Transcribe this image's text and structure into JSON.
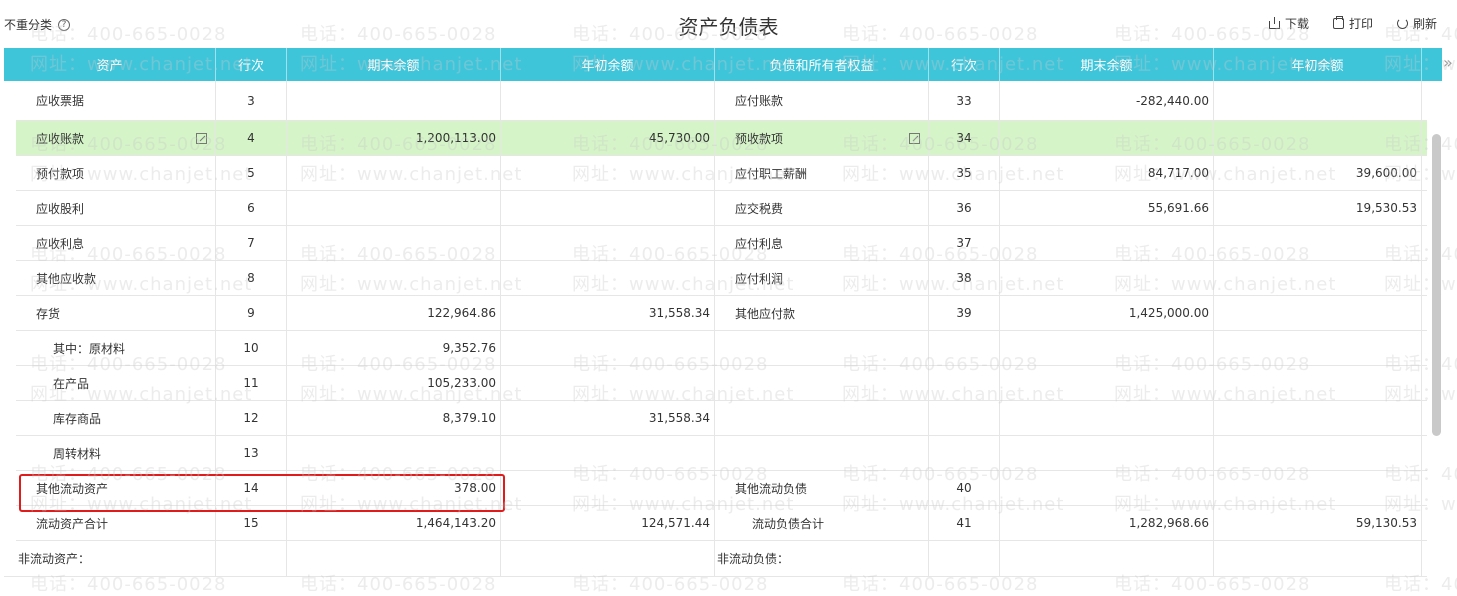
{
  "top": {
    "option_label": "不重分类",
    "help_icon": "?",
    "title": "资产负债表",
    "download": "下载",
    "print": "打印",
    "refresh": "刷新"
  },
  "columns": [
    "资产",
    "行次",
    "期末余额",
    "年初余额",
    "负债和所有者权益",
    "行次",
    "期末余额",
    "年初余额"
  ],
  "rows": [
    {
      "a": "应收票据",
      "an": "3",
      "ae": "",
      "ab": "",
      "l": "应付账款",
      "ln": "33",
      "le": "-282,440.00",
      "lb": ""
    },
    {
      "a": "应收账款",
      "an": "4",
      "ae": "1,200,113.00",
      "ab": "45,730.00",
      "l": "预收款项",
      "ln": "34",
      "le": "",
      "lb": ""
    },
    {
      "a": "预付款项",
      "an": "5",
      "ae": "",
      "ab": "",
      "l": "应付职工薪酬",
      "ln": "35",
      "le": "84,717.00",
      "lb": "39,600.00"
    },
    {
      "a": "应收股利",
      "an": "6",
      "ae": "",
      "ab": "",
      "l": "应交税费",
      "ln": "36",
      "le": "55,691.66",
      "lb": "19,530.53"
    },
    {
      "a": "应收利息",
      "an": "7",
      "ae": "",
      "ab": "",
      "l": "应付利息",
      "ln": "37",
      "le": "",
      "lb": ""
    },
    {
      "a": "其他应收款",
      "an": "8",
      "ae": "",
      "ab": "",
      "l": "应付利润",
      "ln": "38",
      "le": "",
      "lb": ""
    },
    {
      "a": "存货",
      "an": "9",
      "ae": "122,964.86",
      "ab": "31,558.34",
      "l": "其他应付款",
      "ln": "39",
      "le": "1,425,000.00",
      "lb": ""
    },
    {
      "a": "其中：原材料",
      "an": "10",
      "ae": "9,352.76",
      "ab": "",
      "l": "",
      "ln": "",
      "le": "",
      "lb": ""
    },
    {
      "a": "在产品",
      "an": "11",
      "ae": "105,233.00",
      "ab": "",
      "l": "",
      "ln": "",
      "le": "",
      "lb": ""
    },
    {
      "a": "库存商品",
      "an": "12",
      "ae": "8,379.10",
      "ab": "31,558.34",
      "l": "",
      "ln": "",
      "le": "",
      "lb": ""
    },
    {
      "a": "周转材料",
      "an": "13",
      "ae": "",
      "ab": "",
      "l": "",
      "ln": "",
      "le": "",
      "lb": ""
    },
    {
      "a": "其他流动资产",
      "an": "14",
      "ae": "378.00",
      "ab": "",
      "l": "其他流动负债",
      "ln": "40",
      "le": "",
      "lb": ""
    },
    {
      "a": "流动资产合计",
      "an": "15",
      "ae": "1,464,143.20",
      "ab": "124,571.44",
      "l": "流动负债合计",
      "ln": "41",
      "le": "1,282,968.66",
      "lb": "59,130.53"
    }
  ],
  "section": {
    "left": "非流动资产：",
    "right": "非流动负债："
  },
  "watermark": {
    "phone": "电话：400-665-0028",
    "site": "网址：www.chanjet.net"
  },
  "colors": {
    "header": "#3fc5da",
    "highlight": "#d5f5c8",
    "negative": "#e43b3b",
    "box": "#e01b1b"
  }
}
